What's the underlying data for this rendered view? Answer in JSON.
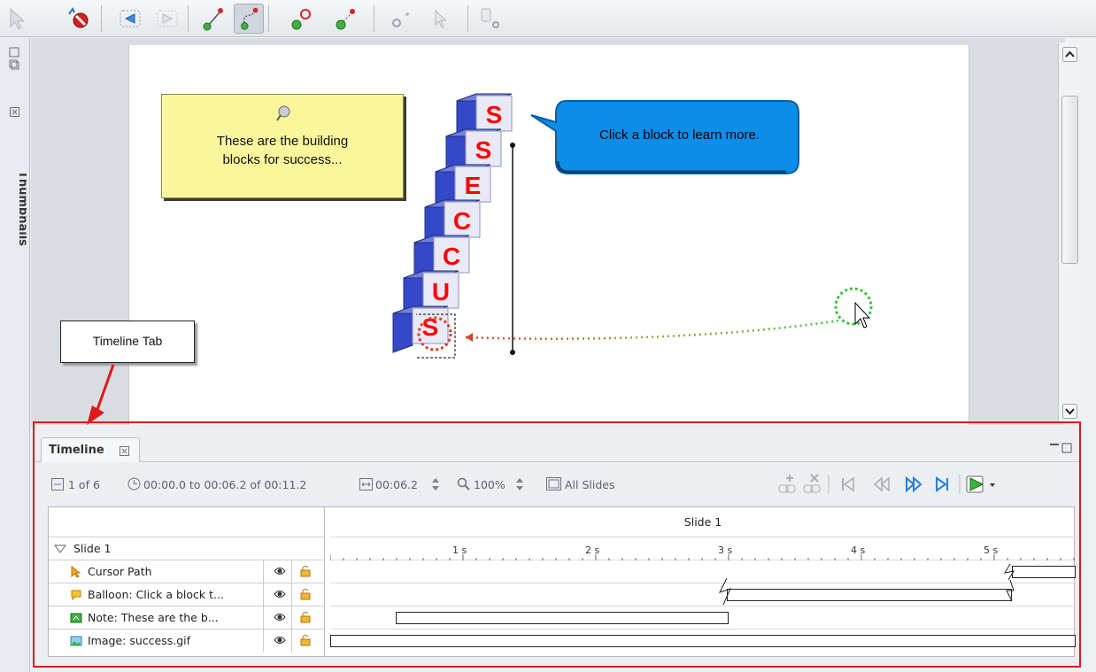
{
  "side_panel": {
    "thumbnails_label": "Thumbnails"
  },
  "slide": {
    "note": {
      "text": "These are the building\nblocks for success..."
    },
    "balloon": {
      "text": "Click a block to learn more."
    },
    "blocks": [
      "S",
      "S",
      "E",
      "C",
      "C",
      "U",
      "S"
    ]
  },
  "callout": {
    "text": "Timeline Tab"
  },
  "timeline": {
    "tab_label": "Timeline",
    "toolbar": {
      "slide_count": "1 of 6",
      "time_range": "00:00.0 to 00:06.2 of 00:11.2",
      "duration": "00:06.2",
      "zoom": "100%",
      "all_slides": "All Slides"
    },
    "header": {
      "slide_title": "Slide 1"
    },
    "rows": [
      {
        "label": "Slide 1"
      },
      {
        "label": "Cursor Path"
      },
      {
        "label": "Balloon: Click a block t..."
      },
      {
        "label": "Note: These are the b..."
      },
      {
        "label": "Image: success.gif"
      }
    ],
    "ruler": [
      "1 s",
      "2 s",
      "3 s",
      "4 s",
      "5 s"
    ]
  },
  "colors": {
    "highlight_red": "#e01818",
    "balloon_blue": "#0b8de8",
    "note_yellow": "#fbf69c",
    "block_red": "#ff0000",
    "block_blue": "#3548c8"
  }
}
